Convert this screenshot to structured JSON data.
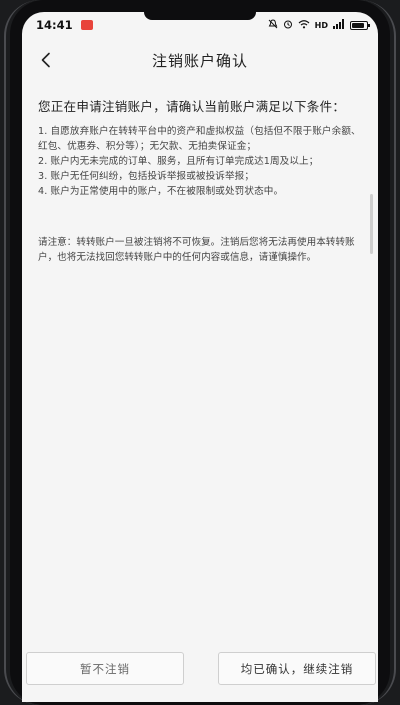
{
  "status_bar": {
    "time": "14:41",
    "badge": "▪",
    "network": "HD"
  },
  "nav": {
    "title": "注销账户确认"
  },
  "content": {
    "intro": "您正在申请注销账户，请确认当前账户满足以下条件：",
    "conditions": [
      "1. 自愿放弃账户在转转平台中的资产和虚拟权益（包括但不限于账户余额、红包、优惠券、积分等）；无欠款、无拍卖保证金；",
      "2. 账户内无未完成的订单、服务，且所有订单完成达1周及以上；",
      "3. 账户无任何纠纷，包括投诉举报或被投诉举报；",
      "4. 账户为正常使用中的账户，不在被限制或处罚状态中。"
    ],
    "notice": "请注意：转转账户一旦被注销将不可恢复。注销后您将无法再使用本转转账户，也将无法找回您转转账户中的任何内容或信息，请谨慎操作。"
  },
  "buttons": {
    "cancel": "暂不注销",
    "confirm": "均已确认，继续注销"
  }
}
